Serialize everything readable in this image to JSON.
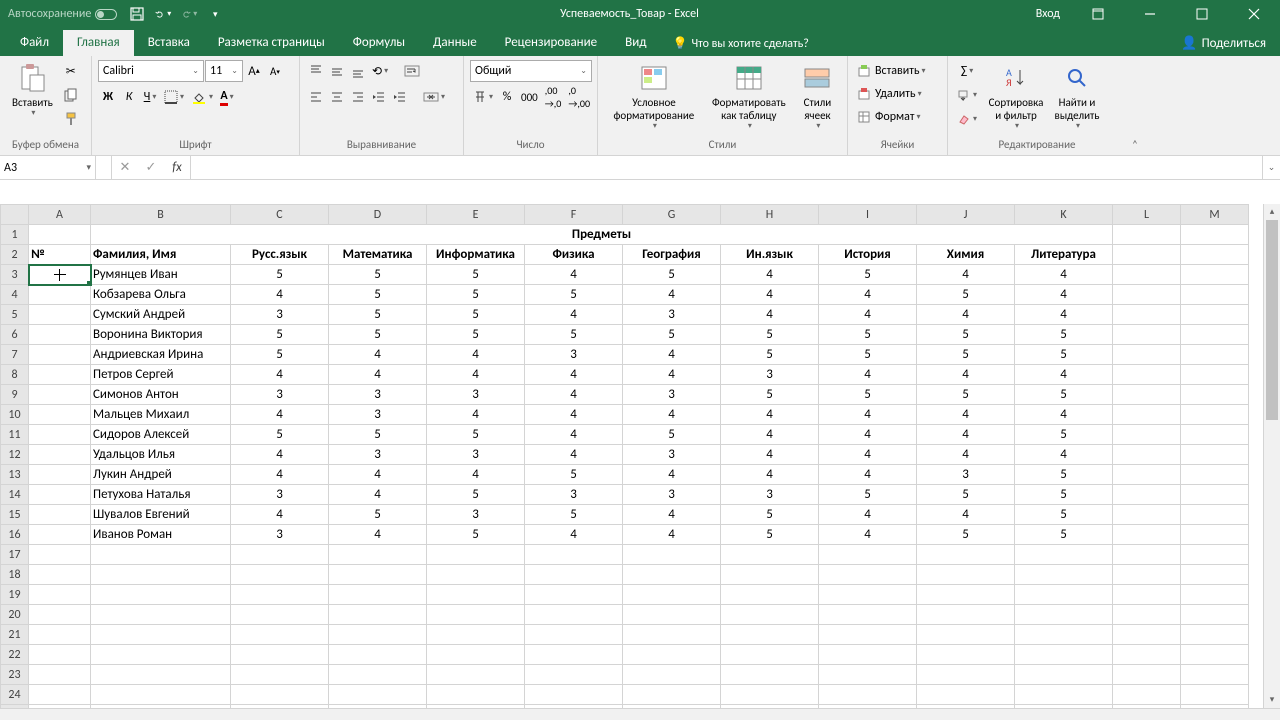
{
  "titlebar": {
    "autosave_label": "Автосохранение",
    "title": "Успеваемость_Товар  -  Excel",
    "login": "Вход"
  },
  "tabs": {
    "file": "Файл",
    "home": "Главная",
    "insert": "Вставка",
    "layout": "Разметка страницы",
    "formulas": "Формулы",
    "data": "Данные",
    "review": "Рецензирование",
    "view": "Вид",
    "tellme": "Что вы хотите сделать?",
    "share": "Поделиться"
  },
  "ribbon": {
    "clipboard": {
      "paste": "Вставить",
      "label": "Буфер обмена"
    },
    "font": {
      "name": "Calibri",
      "size": "11",
      "label": "Шрифт"
    },
    "align": {
      "label": "Выравнивание"
    },
    "number": {
      "format": "Общий",
      "label": "Число"
    },
    "styles": {
      "cond": "Условное форматирование",
      "table": "Форматировать как таблицу",
      "cell": "Стили ячеек",
      "label": "Стили"
    },
    "cells": {
      "insert": "Вставить",
      "delete": "Удалить",
      "format": "Формат",
      "label": "Ячейки"
    },
    "editing": {
      "sort": "Сортировка и фильтр",
      "find": "Найти и выделить",
      "label": "Редактирование"
    }
  },
  "namebox": "A3",
  "grid": {
    "columns": [
      "A",
      "B",
      "C",
      "D",
      "E",
      "F",
      "G",
      "H",
      "I",
      "J",
      "K",
      "L",
      "M"
    ],
    "merged_header": "Предметы",
    "headers": {
      "A": "№",
      "B": "Фамилия, Имя",
      "C": "Русс.язык",
      "D": "Математика",
      "E": "Информатика",
      "F": "Физика",
      "G": "География",
      "H": "Ин.язык",
      "I": "История",
      "J": "Химия",
      "K": "Литература"
    },
    "rows": [
      {
        "name": "Румянцев Иван",
        "g": [
          5,
          5,
          5,
          4,
          5,
          4,
          5,
          4,
          4
        ]
      },
      {
        "name": "Кобзарева Ольга",
        "g": [
          4,
          5,
          5,
          5,
          4,
          4,
          4,
          5,
          4
        ]
      },
      {
        "name": "Сумский Андрей",
        "g": [
          3,
          5,
          5,
          4,
          3,
          4,
          4,
          4,
          4
        ]
      },
      {
        "name": "Воронина Виктория",
        "g": [
          5,
          5,
          5,
          5,
          5,
          5,
          5,
          5,
          5
        ]
      },
      {
        "name": "Андриевская Ирина",
        "g": [
          5,
          4,
          4,
          3,
          4,
          5,
          5,
          5,
          5
        ]
      },
      {
        "name": "Петров Сергей",
        "g": [
          4,
          4,
          4,
          4,
          4,
          3,
          4,
          4,
          4
        ]
      },
      {
        "name": "Симонов Антон",
        "g": [
          3,
          3,
          3,
          4,
          3,
          5,
          5,
          5,
          5
        ]
      },
      {
        "name": "Мальцев Михаил",
        "g": [
          4,
          3,
          4,
          4,
          4,
          4,
          4,
          4,
          4
        ]
      },
      {
        "name": "Сидоров Алексей",
        "g": [
          5,
          5,
          5,
          4,
          5,
          4,
          4,
          4,
          5
        ]
      },
      {
        "name": "Удальцов Илья",
        "g": [
          4,
          3,
          3,
          4,
          3,
          4,
          4,
          4,
          4
        ]
      },
      {
        "name": "Лукин Андрей",
        "g": [
          4,
          4,
          4,
          5,
          4,
          4,
          4,
          3,
          5
        ]
      },
      {
        "name": "Петухова Наталья",
        "g": [
          3,
          4,
          5,
          3,
          3,
          3,
          5,
          5,
          5
        ]
      },
      {
        "name": "Шувалов Евгений",
        "g": [
          4,
          5,
          3,
          5,
          4,
          5,
          4,
          4,
          5
        ]
      },
      {
        "name": "Иванов Роман",
        "g": [
          3,
          4,
          5,
          4,
          4,
          5,
          4,
          5,
          5
        ]
      }
    ],
    "total_rows_shown": 25
  }
}
